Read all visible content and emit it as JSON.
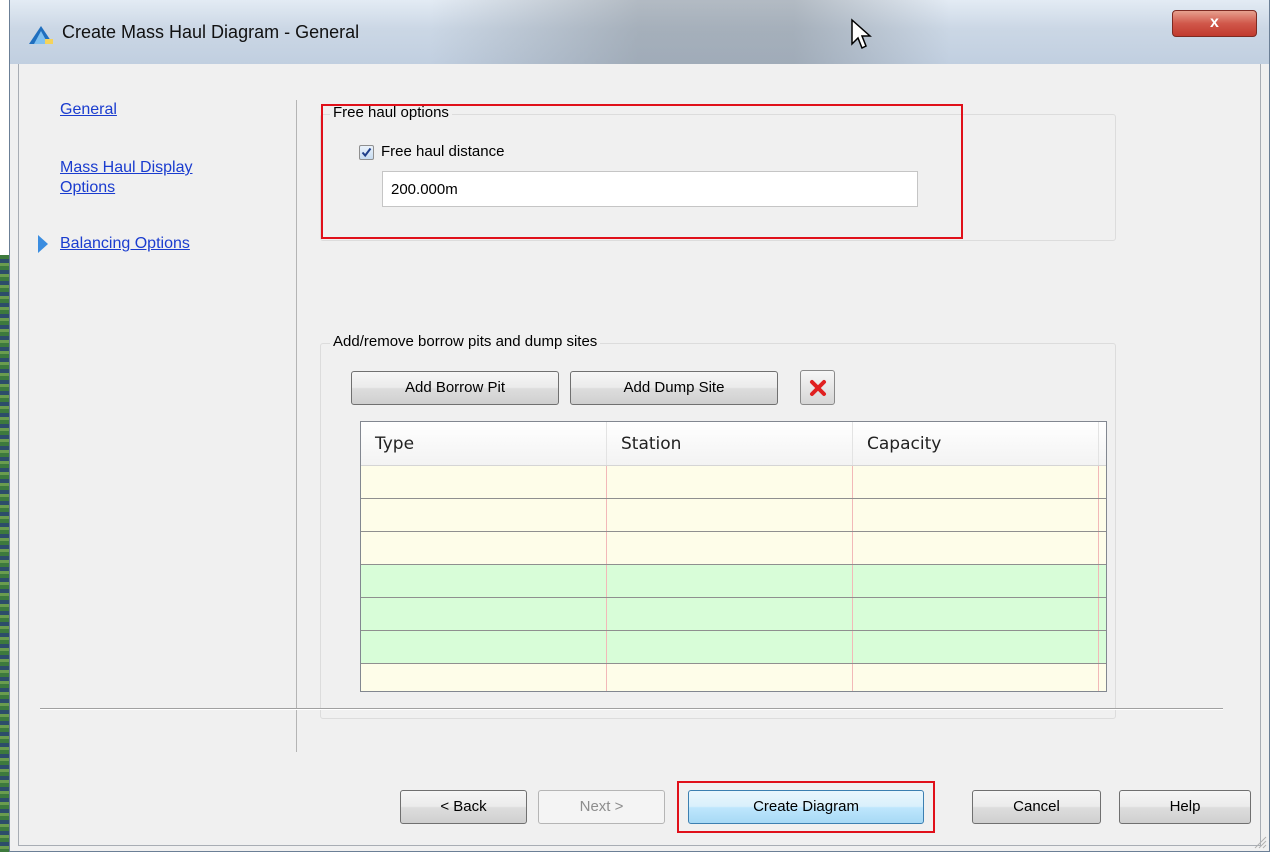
{
  "window": {
    "title": "Create Mass Haul Diagram - General",
    "close_label": "x"
  },
  "nav": {
    "items": [
      {
        "label": "General"
      },
      {
        "label": "Mass Haul Display Options"
      },
      {
        "label": "Balancing Options",
        "current": true
      }
    ]
  },
  "free_haul": {
    "group_title": "Free haul options",
    "checkbox_label": "Free haul distance",
    "checked": true,
    "distance_value": "200.000m"
  },
  "sites": {
    "group_title": "Add/remove borrow pits and dump sites",
    "add_borrow_pit_label": "Add Borrow Pit",
    "add_dump_site_label": "Add Dump Site",
    "delete_icon": "red-x-delete-icon",
    "columns": [
      "Type",
      "Station",
      "Capacity"
    ],
    "rows": [
      {
        "type": "",
        "station": "",
        "capacity": "",
        "color": "#fefde9"
      },
      {
        "type": "",
        "station": "",
        "capacity": "",
        "color": "#fefde9"
      },
      {
        "type": "",
        "station": "",
        "capacity": "",
        "color": "#fefde9"
      },
      {
        "type": "",
        "station": "",
        "capacity": "",
        "color": "#d8fdd8"
      },
      {
        "type": "",
        "station": "",
        "capacity": "",
        "color": "#d8fdd8"
      },
      {
        "type": "",
        "station": "",
        "capacity": "",
        "color": "#d8fdd8"
      },
      {
        "type": "",
        "station": "",
        "capacity": "",
        "color": "#fefde9"
      }
    ]
  },
  "footer": {
    "back_label": "< Back",
    "next_label": "Next >",
    "create_label": "Create Diagram",
    "cancel_label": "Cancel",
    "help_label": "Help"
  },
  "colors": {
    "highlight": "#e0101a",
    "link": "#1a3ccf",
    "row_yellow": "#fefde9",
    "row_green": "#d8fdd8"
  }
}
